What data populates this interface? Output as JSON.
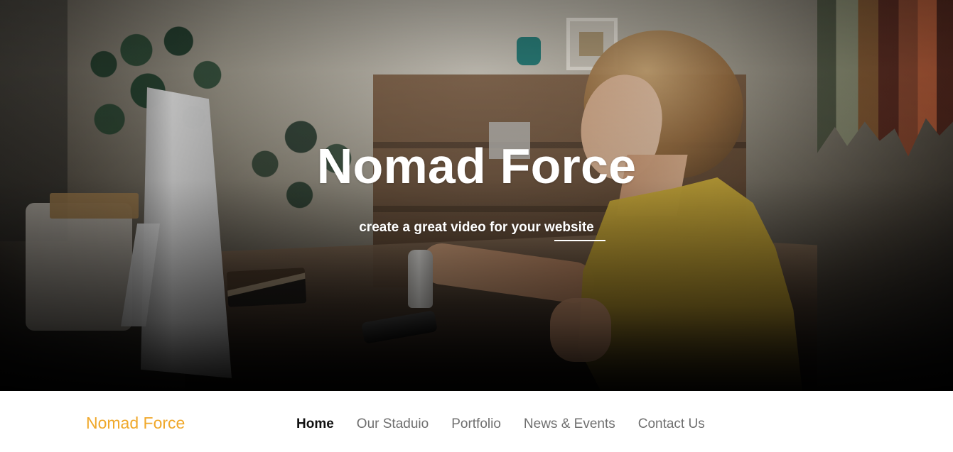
{
  "hero": {
    "title": "Nomad Force",
    "subtitle": "create a great video for your website"
  },
  "navbar": {
    "brand": "Nomad Force",
    "items": [
      {
        "label": "Home",
        "active": true
      },
      {
        "label": "Our Staduio",
        "active": false
      },
      {
        "label": "Portfolio",
        "active": false
      },
      {
        "label": "News & Events",
        "active": false
      },
      {
        "label": "Contact Us",
        "active": false
      }
    ]
  },
  "colors": {
    "brand": "#f0a82a",
    "active_nav": "#111111",
    "inactive_nav": "#6f6f6f",
    "hero_text": "#ffffff"
  }
}
